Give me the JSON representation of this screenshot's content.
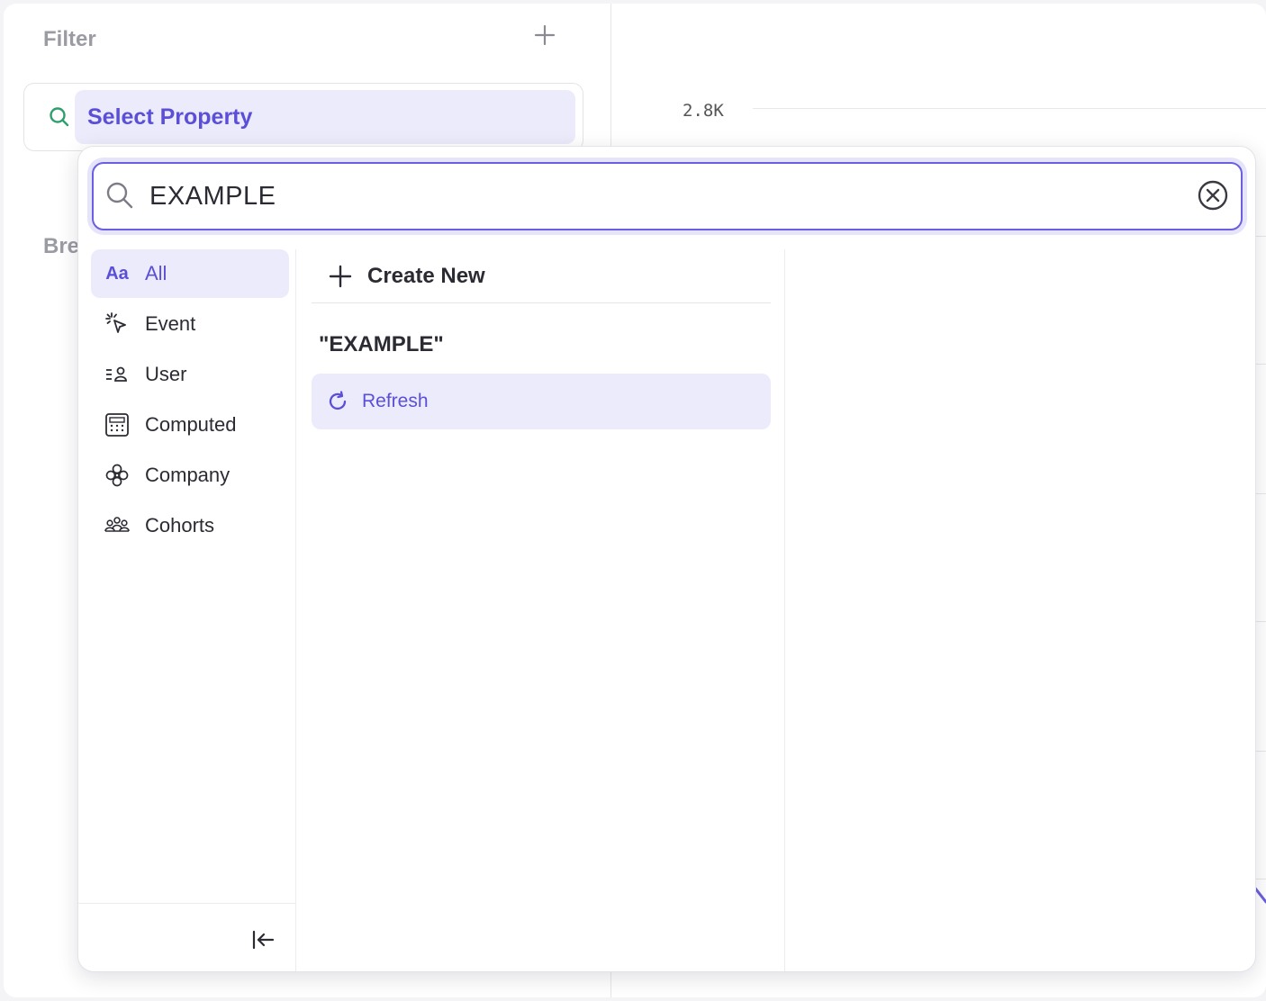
{
  "filter": {
    "title": "Filter",
    "select_property_label": "Select Property"
  },
  "breakdown": {
    "title_fragment": "Bre"
  },
  "chart": {
    "y_tick_label": "2.8K",
    "accent_color": "#6a5fe0"
  },
  "dropdown": {
    "search": {
      "value": "EXAMPLE"
    },
    "categories": [
      {
        "label": "All",
        "icon": "aa-icon",
        "active": true
      },
      {
        "label": "Event",
        "icon": "event-icon",
        "active": false
      },
      {
        "label": "User",
        "icon": "user-icon",
        "active": false
      },
      {
        "label": "Computed",
        "icon": "calculator-icon",
        "active": false
      },
      {
        "label": "Company",
        "icon": "company-icon",
        "active": false
      },
      {
        "label": "Cohorts",
        "icon": "cohorts-icon",
        "active": false
      }
    ],
    "create_new_label": "Create New",
    "query_label": "\"EXAMPLE\"",
    "refresh_label": "Refresh"
  },
  "colors": {
    "accent": "#5b4fd8",
    "highlight_bg": "#ebebfb",
    "muted_text": "#9b9ba3"
  }
}
